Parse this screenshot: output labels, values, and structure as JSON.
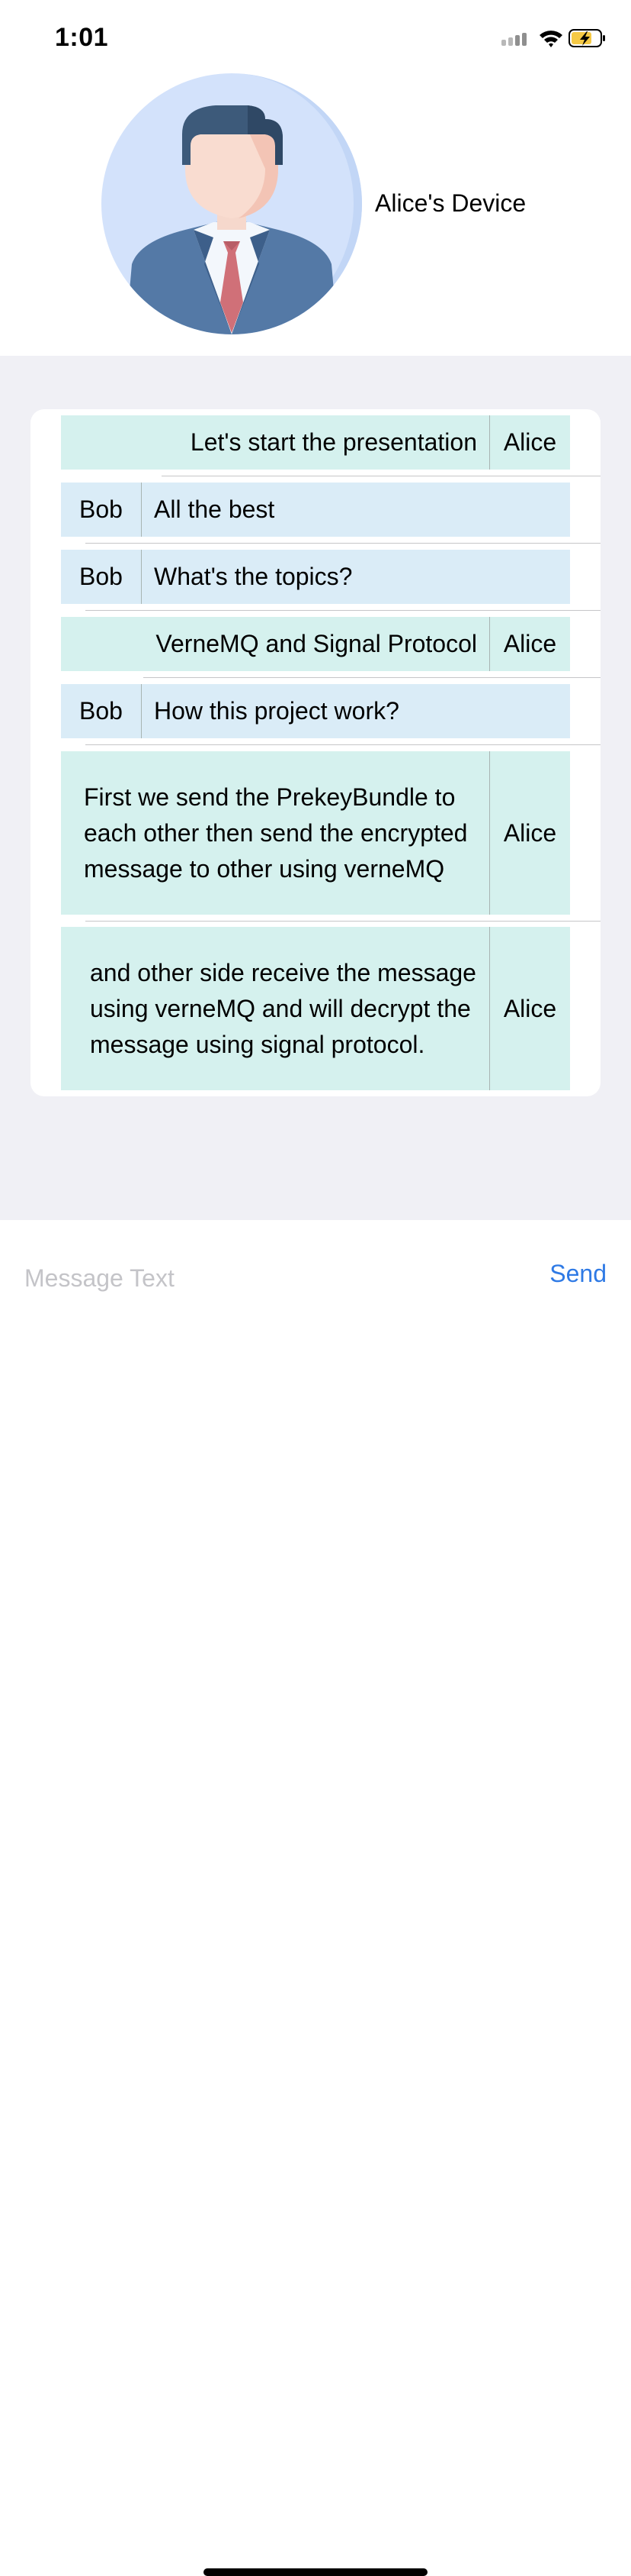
{
  "status_bar": {
    "time": "1:01",
    "icons": [
      "cellular-signal-icon",
      "wifi-icon",
      "battery-charging-icon"
    ],
    "battery_color": "#f5c945"
  },
  "header": {
    "avatar_icon": "businessman-avatar-icon",
    "device_name": "Alice's Device"
  },
  "messages": [
    {
      "sender": "Alice",
      "side": "right",
      "text": "Let's start the presentation"
    },
    {
      "sender": "Bob",
      "side": "left",
      "text": "All the best"
    },
    {
      "sender": "Bob",
      "side": "left",
      "text": "What's the topics?"
    },
    {
      "sender": "Alice",
      "side": "right",
      "text": "VerneMQ and Signal Protocol"
    },
    {
      "sender": "Bob",
      "side": "left",
      "text": "How this project work?"
    },
    {
      "sender": "Alice",
      "side": "right",
      "text": "First we send the PrekeyBundle to each other then send the encrypted message to other using verneMQ"
    },
    {
      "sender": "Alice",
      "side": "right",
      "text": "and other side receive the message using verneMQ and will decrypt the message using signal protocol."
    }
  ],
  "colors": {
    "alice_bubble": "#d5f1ee",
    "bob_bubble": "#daecf7",
    "chat_background": "#f0f0f5",
    "accent": "#2f7ae5"
  },
  "composer": {
    "placeholder": "Message Text",
    "value": "",
    "send_label": "Send"
  }
}
